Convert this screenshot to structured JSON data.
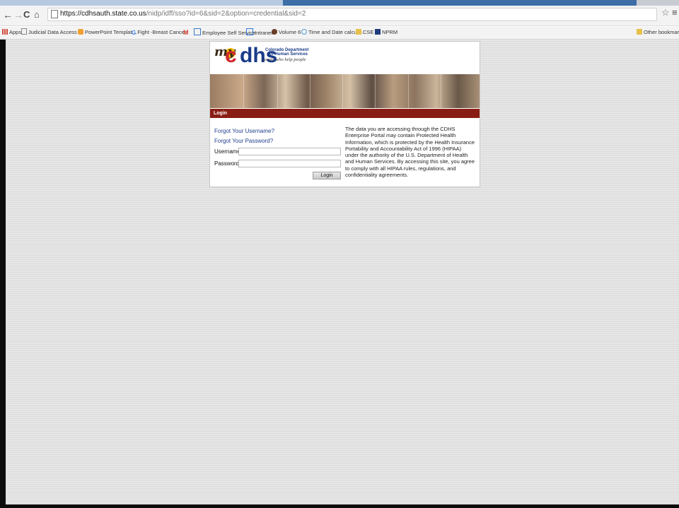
{
  "browser": {
    "url_host": "https://cdhsauth.state.co.us",
    "url_path": "/nidp/idff/sso?id=6&sid=2&option=credential&sid=2",
    "nav": {
      "back": "←",
      "forward": "→",
      "reload": "C",
      "home": "⌂"
    },
    "star": "☆",
    "menu": "≡",
    "bookmarks": [
      {
        "label": "Apps",
        "icon": "apps-grid-icon",
        "color": "#d04a3a"
      },
      {
        "label": "Judicial Data Access",
        "icon": "page-icon",
        "color": "#888888"
      },
      {
        "label": "PowerPoint Templat…",
        "icon": "ppt-icon",
        "color": "#f0a030"
      },
      {
        "label": "Fight -Breast Cancer-",
        "icon": "google-icon",
        "color": "#4285f4"
      },
      {
        "label": "",
        "icon": "gmail-icon",
        "color": "#d44638"
      },
      {
        "label": "Employee Self Service",
        "icon": "ess-icon",
        "color": "#3b78c8"
      },
      {
        "label": "Intranet",
        "icon": "intranet-icon",
        "color": "#2f7ad9"
      },
      {
        "label": "Volume 6",
        "icon": "volume-icon",
        "color": "#6b3d2a"
      },
      {
        "label": "Time and Date calcul…",
        "icon": "clock-icon",
        "color": "#4aa0d8"
      },
      {
        "label": "CSE",
        "icon": "folder-icon",
        "color": "#e6c04a"
      },
      {
        "label": "NPRM",
        "icon": "nprm-icon",
        "color": "#1f3c7a"
      }
    ],
    "other_bookmarks": "Other bookmarks"
  },
  "branding": {
    "logo_my": "my",
    "logo_c": "c",
    "logo_hs": "dhs",
    "dept_line1": "Colorado Department",
    "dept_line2": "of Human Services",
    "tagline": "people who help people"
  },
  "login": {
    "header": "Login",
    "forgot_username": "Forgot Your Username?",
    "forgot_password": "Forgot Your Password?",
    "username_label": "Username:",
    "password_label": "Password:",
    "username_value": "",
    "password_value": "",
    "button": "Login",
    "disclaimer": "The data you are accessing through the CDHS Enterprise Portal may contain Protected Health Information, which is protected by the Health Insurance Portability and Accountability Act of 1996 (HIPAA) under the authority of the U.S. Department of Health and Human Services. By accessing this site, you agree to comply with all HIPAA rules, regulations, and confidentiality agreements."
  }
}
